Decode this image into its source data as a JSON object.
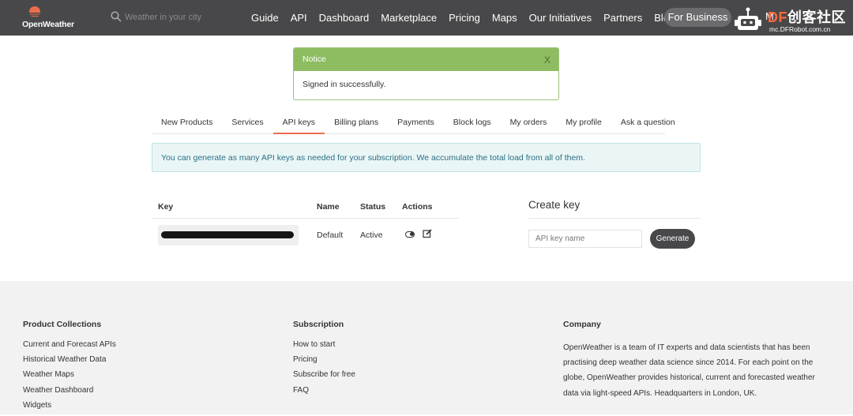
{
  "brand": {
    "name": "OpenWeather",
    "accent": "#eb6e4b",
    "nav_bg": "#48484a"
  },
  "search": {
    "placeholder": "Weather in your city"
  },
  "nav": {
    "links": [
      "Guide",
      "API",
      "Dashboard",
      "Marketplace",
      "Pricing",
      "Maps",
      "Our Initiatives",
      "Partners",
      "Blog"
    ],
    "business_button": "For Business"
  },
  "watermark": {
    "mc": "M",
    "title_df": "DF",
    "title_rest": "创客社区",
    "url": "mc.DFRobot.com.cn"
  },
  "notice": {
    "title": "Notice",
    "close": "X",
    "message": "Signed in successfully."
  },
  "tabs": [
    {
      "label": "New Products",
      "active": false
    },
    {
      "label": "Services",
      "active": false
    },
    {
      "label": "API keys",
      "active": true
    },
    {
      "label": "Billing plans",
      "active": false
    },
    {
      "label": "Payments",
      "active": false
    },
    {
      "label": "Block logs",
      "active": false
    },
    {
      "label": "My orders",
      "active": false
    },
    {
      "label": "My profile",
      "active": false
    },
    {
      "label": "Ask a question",
      "active": false
    }
  ],
  "info": {
    "text": "You can generate as many API keys as needed for your subscription. We accumulate the total load from all of them."
  },
  "keys_table": {
    "headers": {
      "key": "Key",
      "name": "Name",
      "status": "Status",
      "actions": "Actions"
    },
    "rows": [
      {
        "name": "Default",
        "status": "Active"
      }
    ]
  },
  "create_key": {
    "title": "Create key",
    "placeholder": "API key name",
    "button": "Generate"
  },
  "footer": {
    "product": {
      "title": "Product Collections",
      "links": [
        "Current and Forecast APIs",
        "Historical Weather Data",
        "Weather Maps",
        "Weather Dashboard",
        "Widgets"
      ]
    },
    "subscription": {
      "title": "Subscription",
      "links": [
        "How to start",
        "Pricing",
        "Subscribe for free",
        "FAQ"
      ]
    },
    "company": {
      "title": "Company",
      "text": "OpenWeather is a team of IT experts and data scientists that has been practising deep weather data science since 2014. For each point on the globe, OpenWeather provides historical, current and forecasted weather data via light-speed APIs. Headquarters in London, UK."
    }
  }
}
